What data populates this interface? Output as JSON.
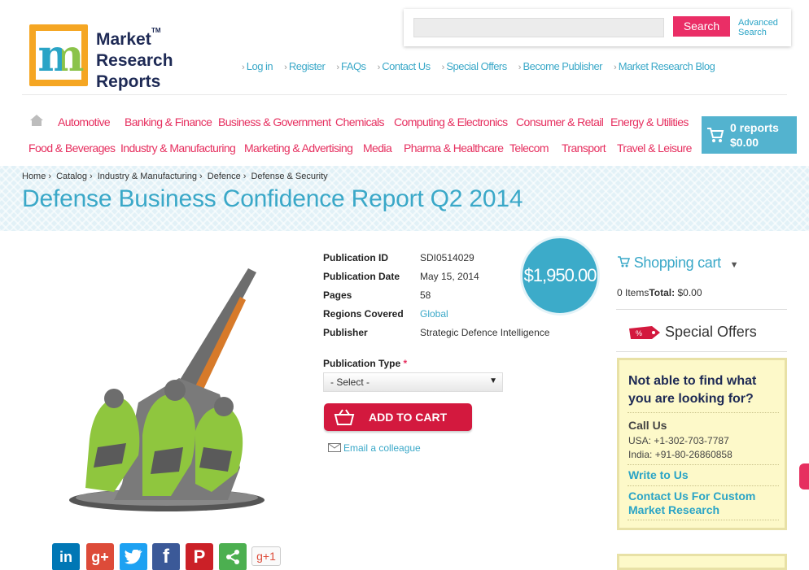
{
  "logo": {
    "line1": "Market",
    "line2": "Research",
    "line3": "Reports",
    "tm": "TM",
    "letter": "m"
  },
  "search": {
    "placeholder": "",
    "button": "Search",
    "advanced": "Advanced Search"
  },
  "topnav": [
    "Log in",
    "Register",
    "FAQs",
    "Contact Us",
    "Special Offers",
    "Become Publisher",
    "Market Research Blog"
  ],
  "categories_row1": [
    "Automotive",
    "Banking & Finance",
    "Business & Government",
    "Chemicals",
    "Computing & Electronics",
    "Consumer & Retail",
    "Energy & Utilities"
  ],
  "categories_row2": [
    "Food & Beverages",
    "Industry & Manufacturing",
    "Marketing & Advertising",
    "Media",
    "Pharma & Healthcare",
    "Telecom",
    "Transport",
    "Travel & Leisure"
  ],
  "cart": {
    "reports": "0 reports",
    "total": "$0.00"
  },
  "breadcrumb": [
    "Home",
    "Catalog",
    "Industry & Manufacturing",
    "Defence",
    "Defense & Security"
  ],
  "title": "Defense Business Confidence Report Q2 2014",
  "details": [
    {
      "k": "Publication ID",
      "v": "SDI0514029"
    },
    {
      "k": "Publication Date",
      "v": "May 15, 2014"
    },
    {
      "k": "Pages",
      "v": "58"
    },
    {
      "k": "Regions Covered",
      "v": "Global"
    },
    {
      "k": "Publisher",
      "v": "Strategic Defence Intelligence"
    }
  ],
  "price": "$1,950.00",
  "publication_type": {
    "label": "Publication Type",
    "required": "*",
    "selected": "- Select -"
  },
  "add_to_cart": "ADD TO CART",
  "email_colleague": "Email a colleague",
  "sidebar": {
    "cart_title": "Shopping cart",
    "items_prefix": "0 Items",
    "total_label": "Total:",
    "total_value": " $0.00",
    "special_offers": "Special Offers",
    "question": "Not able to find what you are looking for?",
    "call_us": "Call Us",
    "usa": "USA: +1-302-703-7787",
    "india": "India: +91-80-26860858",
    "write": "Write to Us",
    "contact_custom": "Contact Us For Custom Market Research"
  },
  "social": {
    "gplus_count": "g+1"
  },
  "colors": {
    "accent": "#3aa8c8",
    "pink": "#e62f5f",
    "cart": "#53b3cf",
    "button": "#d3193e"
  }
}
